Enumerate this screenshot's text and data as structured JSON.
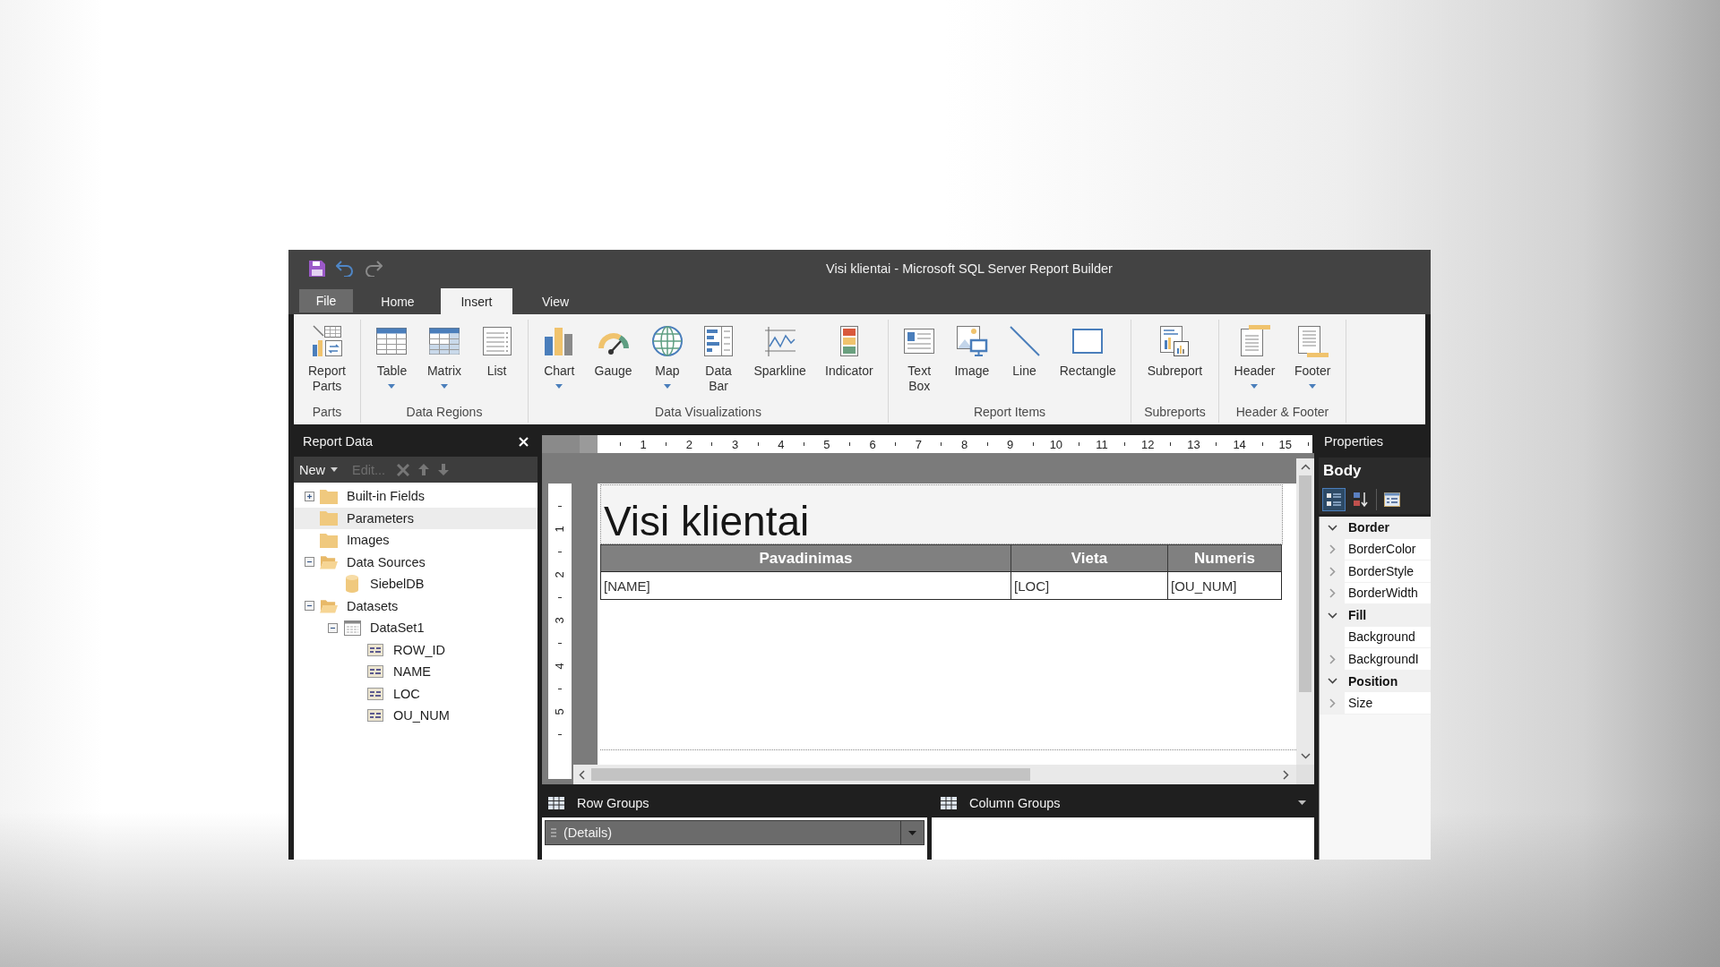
{
  "window": {
    "title": "Visi klientai - Microsoft SQL Server Report Builder",
    "quick_access": [
      {
        "kind": "save",
        "disabled": false
      },
      {
        "kind": "undo",
        "disabled": false
      },
      {
        "kind": "redo",
        "disabled": true
      }
    ]
  },
  "tabs": [
    {
      "label": "File",
      "kind": "file",
      "selected": false
    },
    {
      "label": "Home",
      "kind": "tab",
      "selected": false
    },
    {
      "label": "Insert",
      "kind": "tab",
      "selected": true
    },
    {
      "label": "View",
      "kind": "tab",
      "selected": false
    }
  ],
  "ribbon": {
    "groups": [
      {
        "label": "Parts",
        "buttons": [
          {
            "kind": "parts",
            "label": "Report\nParts",
            "dropdown": false
          }
        ]
      },
      {
        "label": "Data Regions",
        "buttons": [
          {
            "kind": "table",
            "label": "Table",
            "dropdown": true
          },
          {
            "kind": "matrix",
            "label": "Matrix",
            "dropdown": true
          },
          {
            "kind": "list",
            "label": "List",
            "dropdown": false
          }
        ]
      },
      {
        "label": "Data Visualizations",
        "buttons": [
          {
            "kind": "chart",
            "label": "Chart",
            "dropdown": true
          },
          {
            "kind": "gauge",
            "label": "Gauge",
            "dropdown": false
          },
          {
            "kind": "map",
            "label": "Map",
            "dropdown": true
          },
          {
            "kind": "databar",
            "label": "Data\nBar",
            "dropdown": false
          },
          {
            "kind": "sparkline",
            "label": "Sparkline",
            "dropdown": false
          },
          {
            "kind": "indicator",
            "label": "Indicator",
            "dropdown": false
          }
        ]
      },
      {
        "label": "Report Items",
        "buttons": [
          {
            "kind": "textbox",
            "label": "Text\nBox",
            "dropdown": false
          },
          {
            "kind": "image",
            "label": "Image",
            "dropdown": false
          },
          {
            "kind": "line",
            "label": "Line",
            "dropdown": false
          },
          {
            "kind": "rectangle",
            "label": "Rectangle",
            "dropdown": false
          }
        ]
      },
      {
        "label": "Subreports",
        "buttons": [
          {
            "kind": "subreport",
            "label": "Subreport",
            "dropdown": false
          }
        ]
      },
      {
        "label": "Header & Footer",
        "buttons": [
          {
            "kind": "header",
            "label": "Header",
            "dropdown": true
          },
          {
            "kind": "footer",
            "label": "Footer",
            "dropdown": true
          }
        ]
      }
    ]
  },
  "report_data": {
    "title": "Report Data",
    "toolbar": [
      {
        "kind": "text",
        "label": "New",
        "dropdown": true,
        "disabled": false
      },
      {
        "kind": "text",
        "label": "Edit...",
        "dropdown": false,
        "disabled": true
      },
      {
        "kind": "delete",
        "disabled": true
      },
      {
        "kind": "up",
        "disabled": true
      },
      {
        "kind": "down",
        "disabled": true
      }
    ],
    "tree": [
      {
        "label": "Built-in Fields",
        "kind": "folder",
        "expanded": false,
        "selected": false
      },
      {
        "label": "Parameters",
        "kind": "folder",
        "selected": true
      },
      {
        "label": "Images",
        "kind": "folder",
        "selected": false
      },
      {
        "label": "Data Sources",
        "kind": "folder",
        "expanded": true,
        "selected": false,
        "children": [
          {
            "label": "SiebelDB",
            "kind": "datasource",
            "selected": false
          }
        ]
      },
      {
        "label": "Datasets",
        "kind": "folder",
        "expanded": true,
        "selected": false,
        "children": [
          {
            "label": "DataSet1",
            "kind": "dataset",
            "expanded": true,
            "selected": false,
            "children": [
              {
                "label": "ROW_ID",
                "kind": "field",
                "selected": false
              },
              {
                "label": "NAME",
                "kind": "field",
                "selected": false
              },
              {
                "label": "LOC",
                "kind": "field",
                "selected": false
              },
              {
                "label": "OU_NUM",
                "kind": "field",
                "selected": false
              }
            ]
          }
        ]
      }
    ]
  },
  "design": {
    "ruler": {
      "horizontal": [
        "1",
        "2",
        "3",
        "4",
        "5",
        "6",
        "7",
        "8",
        "9",
        "10",
        "11",
        "12",
        "13",
        "14",
        "15"
      ],
      "vertical": [
        "1",
        "2",
        "3",
        "4",
        "5"
      ]
    },
    "report_title": "Visi klientai",
    "table": {
      "columns": [
        "Pavadinimas",
        "Vieta",
        "Numeris"
      ],
      "rows": [
        [
          "[NAME]",
          "[LOC]",
          "[OU_NUM]"
        ]
      ]
    }
  },
  "groups": {
    "row_groups": {
      "label": "Row Groups",
      "items": [
        "(Details)"
      ]
    },
    "column_groups": {
      "label": "Column Groups"
    }
  },
  "properties": {
    "title": "Properties",
    "object": "Body",
    "toolbar": [
      {
        "kind": "categorized",
        "selected": true
      },
      {
        "kind": "alphabetical",
        "selected": false
      },
      {
        "kind": "pages",
        "selected": false
      }
    ],
    "categories": [
      {
        "name": "Border",
        "expanded": true,
        "children": [
          {
            "name": "BorderColor",
            "expanded": false
          },
          {
            "name": "BorderStyle",
            "expanded": false
          },
          {
            "name": "BorderWidth",
            "expanded": false
          }
        ]
      },
      {
        "name": "Fill",
        "expanded": true,
        "children": [
          {
            "name": "Background"
          },
          {
            "name": "BackgroundI",
            "expanded": false
          }
        ]
      },
      {
        "name": "Position",
        "expanded": true,
        "children": [
          {
            "name": "Size",
            "expanded": false
          }
        ]
      }
    ]
  }
}
